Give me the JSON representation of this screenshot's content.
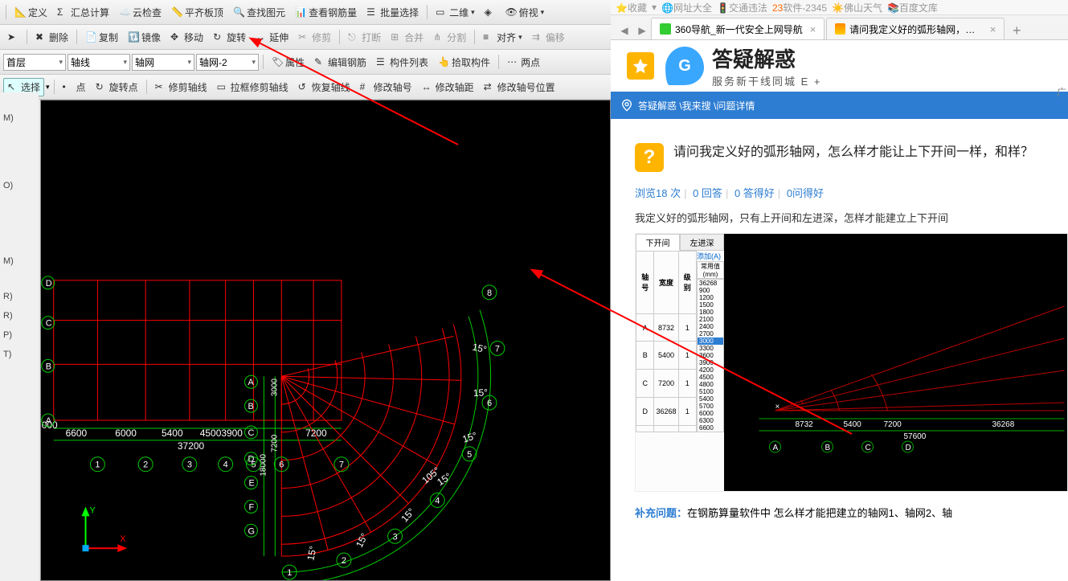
{
  "toolbar1": {
    "define": "定义",
    "sum": "汇总计算",
    "cloud": "云检查",
    "align": "平齐板顶",
    "findimg": "查找图元",
    "rebar": "查看钢筋量",
    "batch": "批量选择",
    "twoD": "二维",
    "persp": "俯视"
  },
  "toolbar2": {
    "del": "删除",
    "copy": "复制",
    "mirror": "镜像",
    "move": "移动",
    "rotate": "旋转",
    "extend": "延伸",
    "trim": "修剪",
    "break": "打断",
    "merge": "合并",
    "split": "分割",
    "alignc": "对齐",
    "offset": "偏移"
  },
  "toolbar3": {
    "floor": "首层",
    "cat1": "轴线",
    "cat2": "轴网",
    "grid": "轴网-2",
    "prop": "属性",
    "editrebar": "编辑钢筋",
    "memberlist": "构件列表",
    "pick": "拾取构件",
    "twopt": "两点"
  },
  "toolbar4": {
    "select": "选择",
    "pt": "点",
    "rpt": "旋转点",
    "trimaxis": "修剪轴线",
    "boxtrim": "拉框修剪轴线",
    "restore": "恢复轴线",
    "modnum": "修改轴号",
    "moddist": "修改轴距",
    "modpos": "修改轴号位置"
  },
  "leftedge": {
    "a": "M)",
    "b": "O)",
    "c": "M)",
    "d": "R)",
    "e": "R)",
    "f": "P)",
    "g": "T)"
  },
  "canvas": {
    "xlabels": [
      "6600",
      "6000",
      "5400",
      "45003900",
      "7200"
    ],
    "totalx": "37200",
    "anglabel": "15°",
    "radlabels": [
      "3000",
      "7200",
      "18000"
    ],
    "radtotal": "18000",
    "angtotal": "105°",
    "rowlabels": [
      "D",
      "C",
      "B",
      "A"
    ],
    "rowlabels2": [
      "A",
      "B",
      "C",
      "D",
      "E",
      "F",
      "G"
    ],
    "collabels": [
      "1",
      "2",
      "3",
      "4",
      "5",
      "6",
      "7"
    ],
    "arclabels": [
      "1",
      "2",
      "3",
      "4",
      "5",
      "6",
      "7",
      "8"
    ],
    "zero": "000"
  },
  "browser": {
    "bookmarks": {
      "fav": "收藏",
      "b1": "网址大全",
      "b2": "交通违法",
      "b3": "软件-2345",
      "b4": "佛山天气",
      "b5": "百度文库"
    },
    "tabs": {
      "t1": "360导航_新一代安全上网导航",
      "t2": "请问我定义好的弧形轴网，怎么样"
    },
    "corner": "广",
    "logo": {
      "g": "G",
      "big": "答疑解惑",
      "sub": "服务新干线同城 E +"
    },
    "breadcrumb": "答疑解惑 \\我来搜 \\问题详情",
    "question": "请问我定义好的弧形轴网，怎么样才能让上下开间一样，和样？",
    "meta": {
      "views": "浏览18 次",
      "ans": "0 回答",
      "good": "0 答得好",
      "ask": "0问得好"
    },
    "desc": "我定义好的弧形轴网，只有上开间和左进深，怎样才能建立上下开间",
    "suppl_label": "补充问题：",
    "suppl": "在钢筋算量软件中 怎么样才能把建立的轴网1、轴网2、轴",
    "embed": {
      "tabs": {
        "a": "下开间",
        "b": "左进深"
      },
      "addbtn": "添加(A)",
      "header": {
        "a": "轴号",
        "b": "宽度",
        "c": "级别"
      },
      "rows": [
        {
          "n": "A",
          "v": "8732",
          "l": "1"
        },
        {
          "n": "B",
          "v": "5400",
          "l": "1"
        },
        {
          "n": "C",
          "v": "7200",
          "l": "1"
        },
        {
          "n": "D",
          "v": "36268",
          "l": "1"
        }
      ],
      "sideheader": "常用值(mm)",
      "sidelist": [
        "36268",
        "900",
        "1200",
        "1500",
        "1800",
        "2100",
        "2400",
        "2700",
        "3000",
        "3300",
        "3600",
        "3900",
        "4200",
        "4500",
        "4800",
        "5100",
        "5400",
        "5700",
        "6000",
        "6300",
        "6600"
      ],
      "xlabels": [
        "8732",
        "5400",
        "7200",
        "36268"
      ],
      "xtotal": "57600",
      "cols": [
        "A",
        "B",
        "C",
        "D"
      ]
    }
  }
}
